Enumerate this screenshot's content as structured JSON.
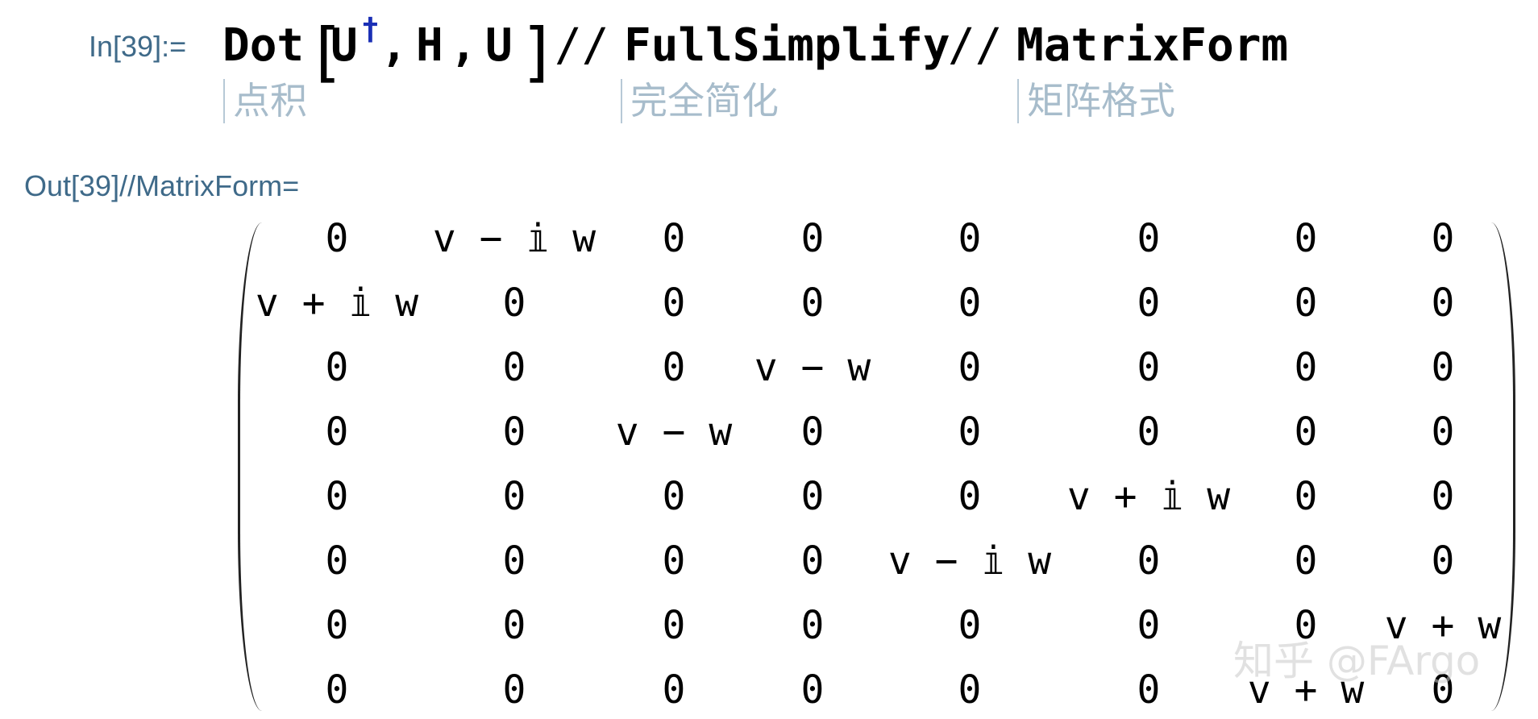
{
  "input": {
    "label": "In[39]:=",
    "tokens": {
      "dot": "Dot",
      "bracket_left": "[",
      "u1": "U",
      "dagger": "†",
      "comma1": ",",
      "h": "H",
      "comma2": ",",
      "u2": "U",
      "bracket_right": "]",
      "op1": "//",
      "fullsimplify": "FullSimplify",
      "op2": "//",
      "matrixform": "MatrixForm"
    },
    "hints": {
      "dot": "点积",
      "fullsimplify": "完全简化",
      "matrixform": "矩阵格式"
    }
  },
  "output": {
    "label": "Out[39]//MatrixForm=",
    "matrix": [
      [
        "0",
        "v − 𝕚 w",
        "0",
        "0",
        "0",
        "0",
        "0",
        "0"
      ],
      [
        "v + 𝕚 w",
        "0",
        "0",
        "0",
        "0",
        "0",
        "0",
        "0"
      ],
      [
        "0",
        "0",
        "0",
        "v − w",
        "0",
        "0",
        "0",
        "0"
      ],
      [
        "0",
        "0",
        "v − w",
        "0",
        "0",
        "0",
        "0",
        "0"
      ],
      [
        "0",
        "0",
        "0",
        "0",
        "0",
        "v + 𝕚 w",
        "0",
        "0"
      ],
      [
        "0",
        "0",
        "0",
        "0",
        "v − 𝕚 w",
        "0",
        "0",
        "0"
      ],
      [
        "0",
        "0",
        "0",
        "0",
        "0",
        "0",
        "0",
        "v + w"
      ],
      [
        "0",
        "0",
        "0",
        "0",
        "0",
        "0",
        "v + w",
        "0"
      ]
    ]
  },
  "watermark": "知乎 @FArgo"
}
